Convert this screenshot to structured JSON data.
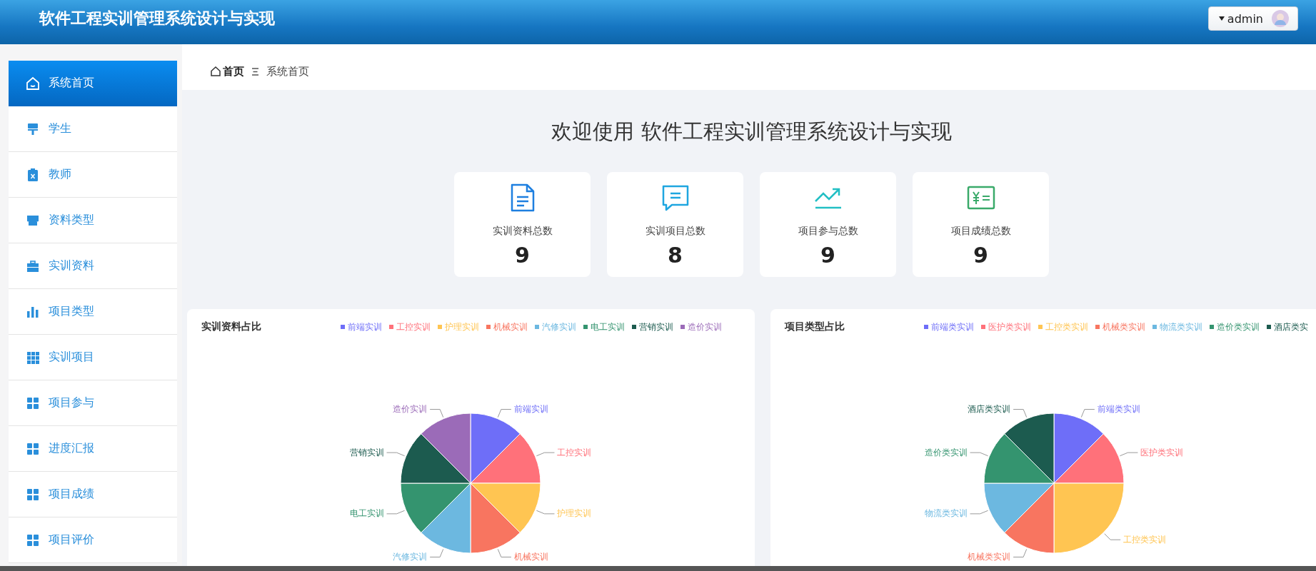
{
  "header": {
    "title": "软件工程实训管理系统设计与实现",
    "user": "admin"
  },
  "sidebar": {
    "items": [
      {
        "label": "系统首页",
        "selected": true
      },
      {
        "label": "学生",
        "selected": false
      },
      {
        "label": "教师",
        "selected": false
      },
      {
        "label": "资料类型",
        "selected": false
      },
      {
        "label": "实训资料",
        "selected": false
      },
      {
        "label": "项目类型",
        "selected": false
      },
      {
        "label": "实训项目",
        "selected": false
      },
      {
        "label": "项目参与",
        "selected": false
      },
      {
        "label": "进度汇报",
        "selected": false
      },
      {
        "label": "项目成绩",
        "selected": false
      },
      {
        "label": "项目评价",
        "selected": false
      }
    ]
  },
  "breadcrumb": {
    "home": "首页",
    "current": "系统首页"
  },
  "welcome": "欢迎使用 软件工程实训管理系统设计与实现",
  "stats": [
    {
      "label": "实训资料总数",
      "value": "9"
    },
    {
      "label": "实训项目总数",
      "value": "8"
    },
    {
      "label": "项目参与总数",
      "value": "9"
    },
    {
      "label": "项目成绩总数",
      "value": "9"
    }
  ],
  "charts": [
    {
      "title": "实训资料占比",
      "legend": [
        {
          "label": "前端实训",
          "color": "#6e6ef8"
        },
        {
          "label": "工控实训",
          "color": "#ff717a"
        },
        {
          "label": "护理实训",
          "color": "#ffc552"
        },
        {
          "label": "机械实训",
          "color": "#f87560"
        },
        {
          "label": "汽修实训",
          "color": "#6cb8e0"
        },
        {
          "label": "电工实训",
          "color": "#34946f"
        },
        {
          "label": "营销实训",
          "color": "#1c5b4f"
        },
        {
          "label": "造价实训",
          "color": "#9b6bb8"
        }
      ],
      "chart_data": {
        "type": "pie",
        "categories": [
          "前端实训",
          "工控实训",
          "护理实训",
          "机械实训",
          "汽修实训",
          "电工实训",
          "营销实训",
          "造价实训"
        ],
        "values": [
          12.5,
          12.5,
          12.5,
          12.5,
          12.5,
          12.5,
          12.5,
          12.5
        ]
      }
    },
    {
      "title": "项目类型占比",
      "legend": [
        {
          "label": "前端类实训",
          "color": "#6e6ef8"
        },
        {
          "label": "医护类实训",
          "color": "#ff717a"
        },
        {
          "label": "工控类实训",
          "color": "#ffc552"
        },
        {
          "label": "机械类实训",
          "color": "#f87560"
        },
        {
          "label": "物流类实训",
          "color": "#6cb8e0"
        },
        {
          "label": "造价类实训",
          "color": "#34946f"
        },
        {
          "label": "酒店类实",
          "color": "#1c5b4f"
        }
      ],
      "chart_data": {
        "type": "pie",
        "categories": [
          "前端类实训",
          "医护类实训",
          "工控类实训",
          "机械类实训",
          "物流类实训",
          "造价类实训",
          "酒店类实训"
        ],
        "values": [
          12.5,
          12.5,
          25,
          12.5,
          12.5,
          12.5,
          12.5
        ]
      }
    }
  ]
}
